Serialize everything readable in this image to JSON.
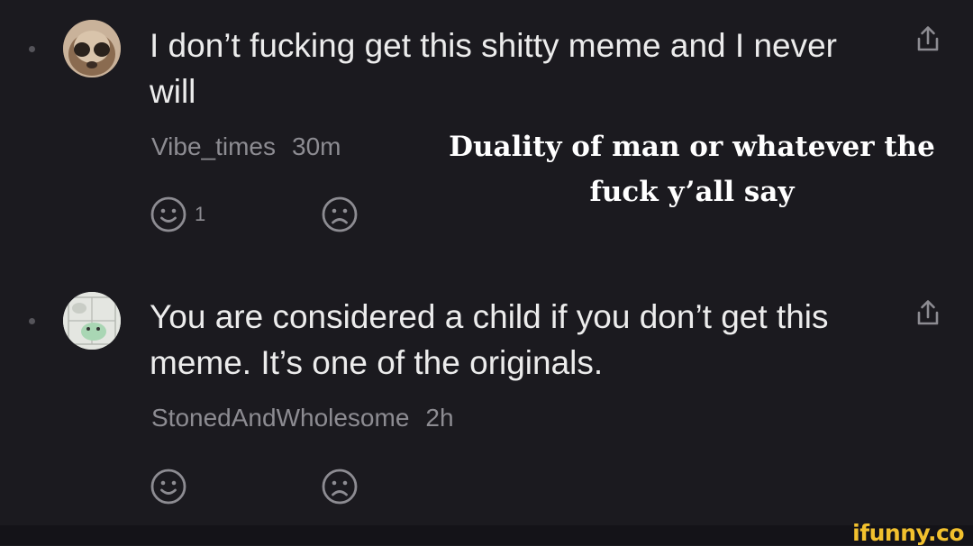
{
  "comments": [
    {
      "text": "I don’t fucking get this shitty meme and I never will",
      "username": "Vibe_times",
      "time": "30m",
      "reactions": {
        "like_count": "1"
      },
      "icons": {
        "share": "share-icon",
        "like": "smile-icon",
        "dislike": "frown-icon"
      }
    },
    {
      "text": "You are considered a child if you don’t get this meme. It’s one of the originals.",
      "username": "StonedAndWholesome",
      "time": "2h",
      "icons": {
        "share": "share-icon",
        "like": "smile-icon",
        "dislike": "frown-icon"
      }
    }
  ],
  "overlay": {
    "line1": "Duality of man or whatever the",
    "line2": "fuck y’all say"
  },
  "watermark": {
    "text": "ifunny.co"
  },
  "colors": {
    "background": "#1b1a1f",
    "text": "#ececec",
    "meta": "#8d8c92",
    "watermark": "#f2c12e"
  }
}
